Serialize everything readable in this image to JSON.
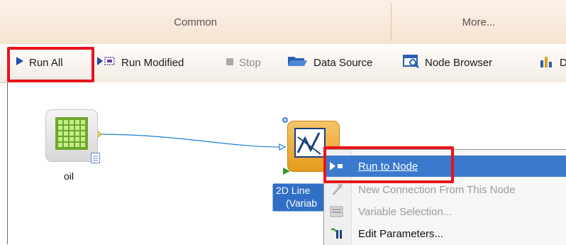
{
  "ribbon": {
    "tabs": [
      {
        "label": "Common"
      },
      {
        "label": "More..."
      }
    ]
  },
  "toolbar": {
    "run_all": "Run All",
    "run_modified": "Run Modified",
    "stop": "Stop",
    "data_source": "Data Source",
    "node_browser": "Node Browser",
    "truncated_next": "D"
  },
  "canvas": {
    "source_node_label": "oil",
    "target_node_label_line1": "2D Line",
    "target_node_label_line2": "(Variab"
  },
  "context_menu": {
    "items": [
      {
        "label": "Run to Node",
        "state": "highlighted",
        "icon": "run-to-node-icon"
      },
      {
        "label": "New Connection From This Node",
        "state": "disabled",
        "icon": "new-connection-icon"
      },
      {
        "label": "Variable Selection...",
        "state": "disabled",
        "icon": "variable-selection-icon"
      },
      {
        "label": "Edit Parameters...",
        "state": "enabled",
        "icon": "edit-parameters-icon"
      }
    ]
  },
  "colors": {
    "highlight_box": "#e8141a",
    "menu_highlight": "#3b79cf",
    "run_arrow": "#1f4fa8"
  }
}
